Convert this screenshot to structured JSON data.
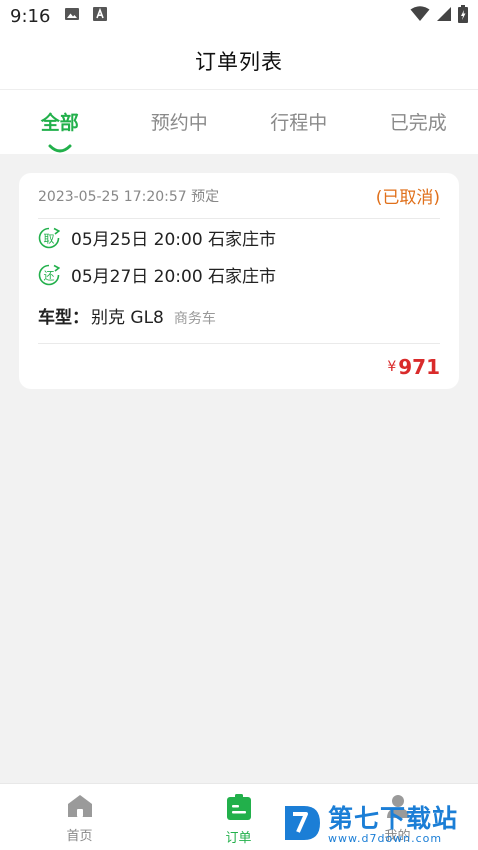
{
  "status_bar": {
    "time": "9:16",
    "icons": [
      "image-icon",
      "font-a-icon",
      "wifi-icon",
      "signal-icon",
      "battery-icon"
    ]
  },
  "header": {
    "title": "订单列表"
  },
  "tabs": [
    {
      "label": "全部",
      "active": true
    },
    {
      "label": "预约中",
      "active": false
    },
    {
      "label": "行程中",
      "active": false
    },
    {
      "label": "已完成",
      "active": false
    }
  ],
  "order": {
    "date": "2023-05-25 17:20:57 预定",
    "status": "(已取消)",
    "pickup": {
      "icon_text": "取",
      "text": "05月25日 20:00 石家庄市"
    },
    "return": {
      "icon_text": "还",
      "text": "05月27日 20:00 石家庄市"
    },
    "car_label": "车型：",
    "car_model": "别克 GL8",
    "car_type": "商务车",
    "price_symbol": "¥",
    "price": "971"
  },
  "bottom_nav": [
    {
      "label": "首页",
      "icon": "home-icon",
      "active": false
    },
    {
      "label": "订单",
      "icon": "order-icon",
      "active": true
    },
    {
      "label": "我的",
      "icon": "profile-icon",
      "active": false
    }
  ],
  "watermark": {
    "main": "第七下载站",
    "sub": "www.d7down.com"
  },
  "colors": {
    "accent": "#22b04b",
    "status_cancelled": "#e0701b",
    "price": "#d92b2b",
    "watermark": "#1b7ed6"
  }
}
